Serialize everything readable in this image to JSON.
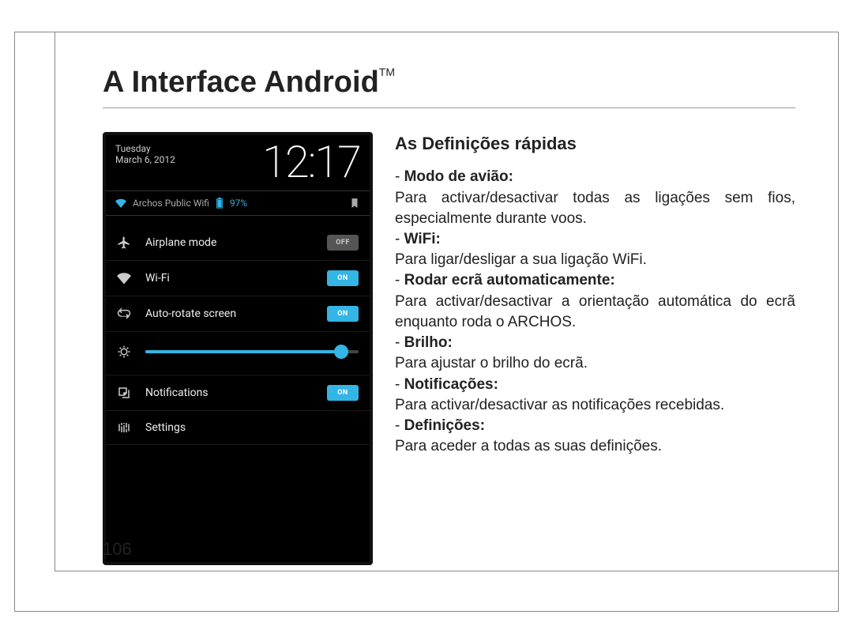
{
  "page": {
    "title": "A Interface Android",
    "trademark": "TM",
    "number": "106"
  },
  "phone": {
    "day": "Tuesday",
    "date": "March 6, 2012",
    "time": "12:17",
    "wifi_name": "Archos Public Wifi",
    "battery_pct": "97%",
    "rows": {
      "airplane": {
        "label": "Airplane mode",
        "toggle": "OFF"
      },
      "wifi": {
        "label": "Wi-Fi",
        "toggle": "ON"
      },
      "autorotate": {
        "label": "Auto-rotate screen",
        "toggle": "ON"
      },
      "notifications": {
        "label": "Notifications",
        "toggle": "ON"
      },
      "settings": {
        "label": "Settings"
      }
    }
  },
  "content": {
    "heading": "As Definições rápidas",
    "items": [
      {
        "title": "Modo de avião:",
        "body": "Para activar/desactivar todas as ligações sem fios, especialmente durante voos."
      },
      {
        "title": "WiFi:",
        "body": "Para ligar/desligar a sua ligação WiFi."
      },
      {
        "title": "Rodar ecrã automaticamente:",
        "body": "Para activar/desactivar a orientação automática do ecrã enquanto roda o ARCHOS."
      },
      {
        "title": "Brilho:",
        "body": "Para ajustar o brilho do ecrã."
      },
      {
        "title": "Notificações:",
        "body": "Para activar/desactivar as notificações recebidas."
      },
      {
        "title": "Definições:",
        "body": "Para aceder a todas as suas definições."
      }
    ]
  }
}
